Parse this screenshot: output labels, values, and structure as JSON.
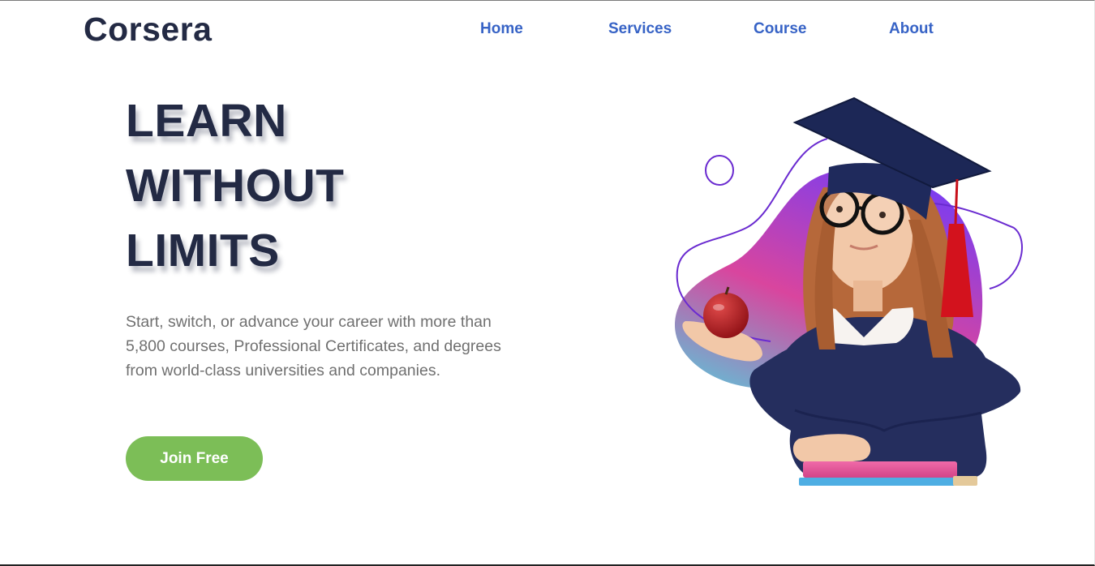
{
  "brand": {
    "name": "Corsera"
  },
  "nav": {
    "items": [
      {
        "label": "Home"
      },
      {
        "label": "Services"
      },
      {
        "label": "Course"
      },
      {
        "label": "About"
      }
    ]
  },
  "hero": {
    "headline_lines": [
      "LEARN",
      "WITHOUT",
      "LIMITS"
    ],
    "description": "Start, switch, or advance your career with more than 5,800 courses, Professional Certificates, and degrees from world-class universities and companies.",
    "cta_label": "Join Free"
  },
  "colors": {
    "brand_dark": "#232a44",
    "nav_link": "#3763c6",
    "cta_green": "#7cbe57",
    "body_text": "#707070",
    "blob_gradient_top": "#7b3df0",
    "blob_gradient_mid": "#d9459e",
    "blob_gradient_bottom": "#5ec3d8"
  },
  "icons": {
    "hero_image": "student-girl-graduation-cap-illustration"
  }
}
